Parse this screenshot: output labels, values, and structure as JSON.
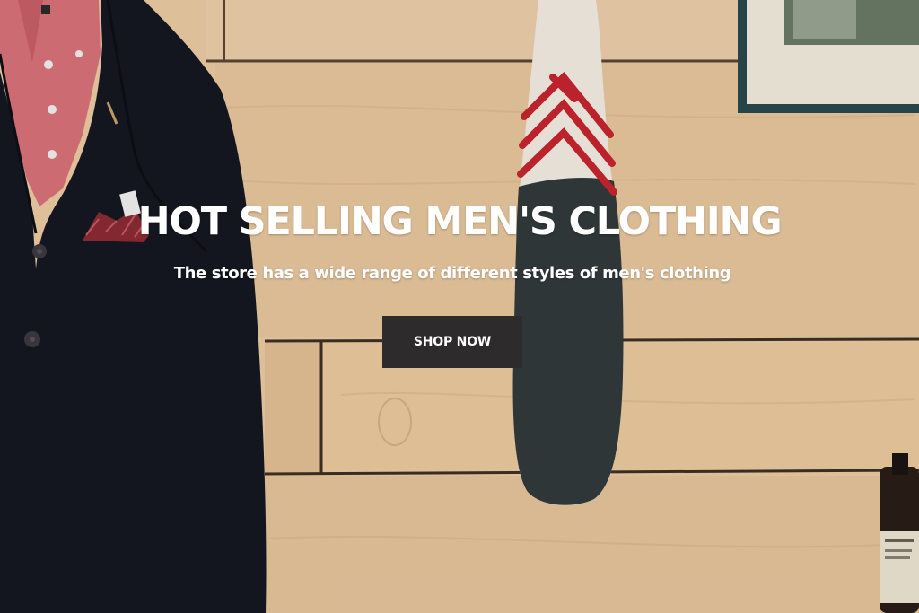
{
  "hero": {
    "title": "HOT SELLING MEN'S CLOTHING",
    "subtitle": "The store has a wide range of different styles of men's clothing",
    "cta_label": "SHOP NOW"
  },
  "colors": {
    "button_background": "#2e2b2d",
    "text": "#ffffff",
    "wood": "#e9c9a1",
    "jacket": "#161821",
    "shirt": "#d9737a",
    "paddle_accent": "#c8252e"
  }
}
